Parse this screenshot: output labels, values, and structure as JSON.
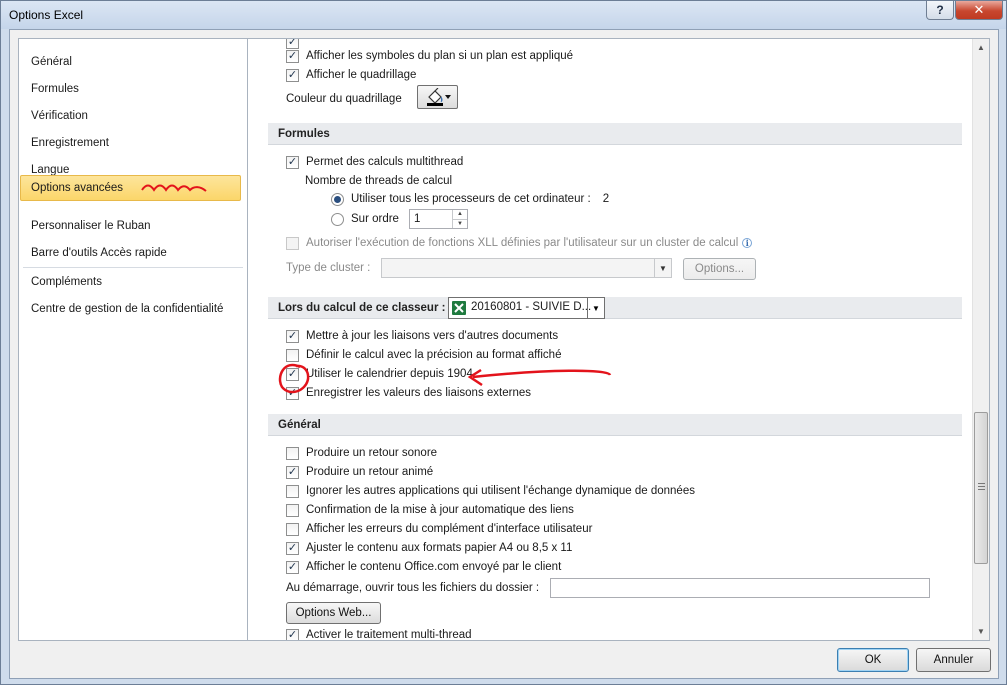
{
  "window": {
    "title": "Options Excel",
    "help_glyph": "?",
    "close_glyph": "✕"
  },
  "nav": {
    "items": [
      "Général",
      "Formules",
      "Vérification",
      "Enregistrement",
      "Langue",
      "Options avancées",
      "Personnaliser le Ruban",
      "Barre d'outils Accès rapide",
      "Compléments",
      "Centre de gestion de la confidentialité"
    ],
    "selected": "Options avancées"
  },
  "display": {
    "outline_symbols": "Afficher les symboles du plan si un plan est appliqué",
    "gridlines": "Afficher le quadrillage",
    "gridline_color_label": "Couleur du quadrillage"
  },
  "formulas": {
    "header": "Formules",
    "multithread": "Permet des calculs multithread",
    "thread_count_label": "Nombre de threads de calcul",
    "use_all_processors": "Utiliser tous les processeurs de cet ordinateur :",
    "processor_count": "2",
    "manual": "Sur ordre",
    "manual_value": "1",
    "xll_cluster": "Autoriser l'exécution de fonctions XLL définies par l'utilisateur sur un cluster de calcul",
    "cluster_type_label": "Type de cluster :",
    "options_button": "Options..."
  },
  "workbook_calc": {
    "header": "Lors du calcul de ce classeur :",
    "workbook": "20160801 - SUIVIE D...",
    "update_links": "Mettre à jour les liaisons vers d'autres documents",
    "precision_as_displayed": "Définir le calcul avec la précision au format affiché",
    "date_1904": "Utiliser le calendrier depuis 1904",
    "save_external_links": "Enregistrer les valeurs des liaisons externes"
  },
  "general": {
    "header": "Général",
    "sound_feedback": "Produire un retour sonore",
    "animation_feedback": "Produire un retour animé",
    "ignore_dde": "Ignorer les autres applications qui utilisent l'échange dynamique de données",
    "confirm_links": "Confirmation de la mise à jour automatique des liens",
    "show_addin_errors": "Afficher les erreurs du complément d'interface utilisateur",
    "scale_paper": "Ajuster le contenu aux formats papier A4 ou 8,5 x 11",
    "show_office_content": "Afficher le contenu Office.com envoyé par le client",
    "startup_folder_label": "Au démarrage, ouvrir tous les fichiers du dossier :",
    "startup_folder_value": "",
    "web_options_button": "Options Web...",
    "multithread_processing": "Activer le traitement multi-thread"
  },
  "footer": {
    "ok": "OK",
    "cancel": "Annuler"
  },
  "colors": {
    "annotation": "#e3131b",
    "selected_nav": "#fbd66a"
  }
}
